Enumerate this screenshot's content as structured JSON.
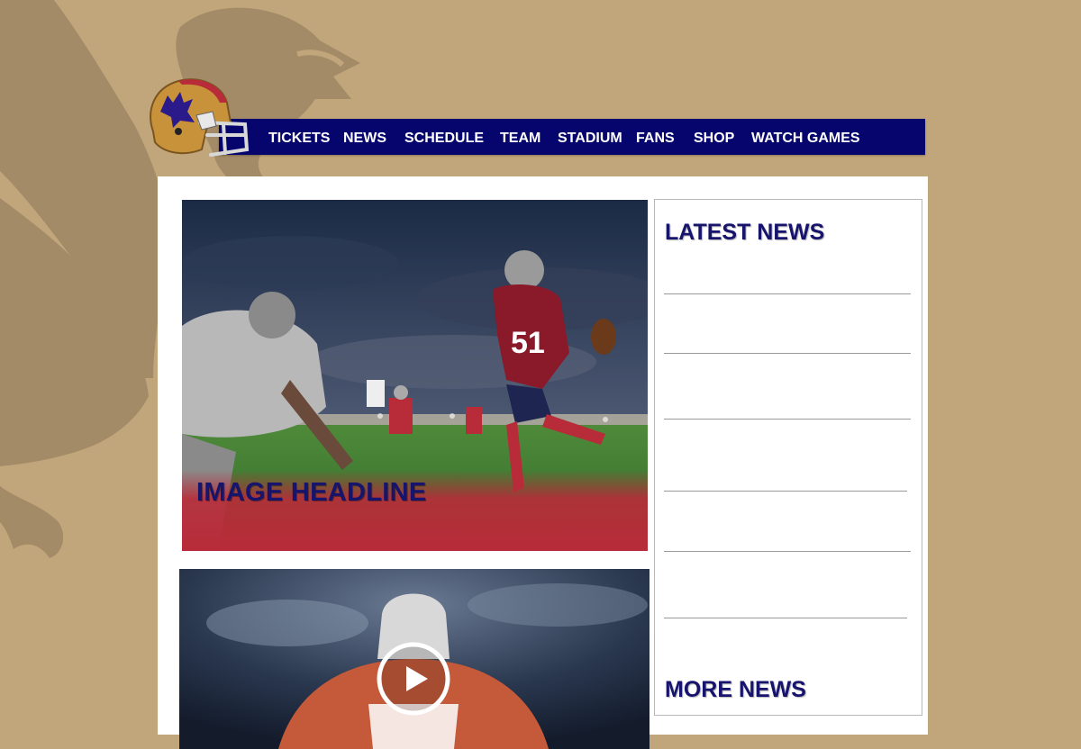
{
  "nav": {
    "items": [
      {
        "label": "TICKETS"
      },
      {
        "label": "NEWS"
      },
      {
        "label": "SCHEDULE"
      },
      {
        "label": "TEAM"
      },
      {
        "label": "STADIUM"
      },
      {
        "label": "FANS"
      },
      {
        "label": "SHOP"
      },
      {
        "label": "WATCH GAMES"
      }
    ]
  },
  "hero": {
    "headline": "IMAGE HEADLINE"
  },
  "news": {
    "heading": "LATEST NEWS",
    "more_label": "MORE NEWS"
  },
  "colors": {
    "page_background": "#c2a67b",
    "nav_background": "#06056e",
    "heading_color": "#17146e",
    "accent_red": "#b82c39",
    "helmet_gold": "#c8923a"
  },
  "icons": {
    "logo": "helmet-logo-icon",
    "video": "play-icon",
    "background": "griffin-emblem"
  }
}
